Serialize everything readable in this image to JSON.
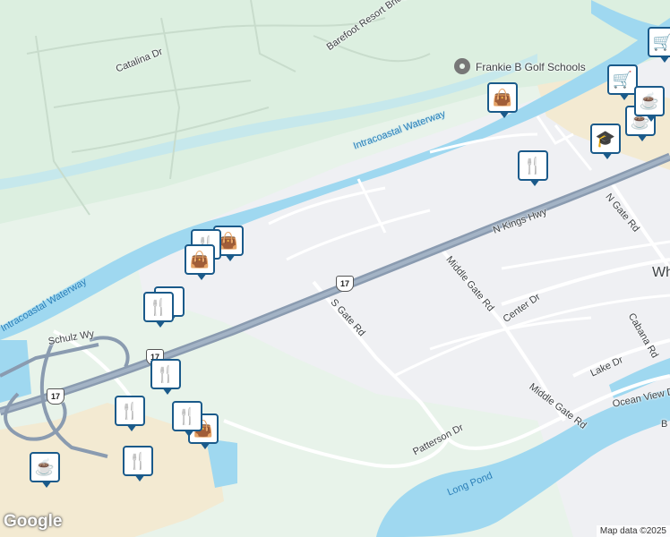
{
  "map": {
    "attribution": "Map data ©2025",
    "logo": "Google",
    "route_shield": "17",
    "colors": {
      "land": "#e8f3ea",
      "urban": "#eff0f3",
      "water": "#9fd8f0",
      "highway": "#8a9bb0",
      "sand": "#f3ead2",
      "pin_border": "#1a5a8a"
    }
  },
  "labels": {
    "catalina_dr": "Catalina Dr",
    "barefoot_bridge": "Barefoot Resort Bridge",
    "frankie_b": "Frankie B Golf Schools",
    "intracoastal_1": "Intracoastal Waterway",
    "intracoastal_2": "Intracoastal Waterway",
    "n_kings_hwy": "N Kings Hwy",
    "schulz_wy": "Schulz Wy",
    "s_gate_rd": "S Gate Rd",
    "middle_gate_rd_1": "Middle Gate Rd",
    "middle_gate_rd_2": "Middle Gate Rd",
    "center_dr": "Center Dr",
    "n_gate_rd": "N Gate Rd",
    "cabana_rd": "Cabana Rd",
    "lake_dr": "Lake Dr",
    "ocean_view_dr": "Ocean View Dr",
    "patterson_dr": "Patterson Dr",
    "long_pond": "Long Pond",
    "wh": "Wh",
    "b": "B"
  },
  "pois": [
    {
      "type": "shopping-bag-icon",
      "glyph": "👜"
    },
    {
      "type": "restaurant-icon",
      "glyph": "🍴"
    },
    {
      "type": "shopping-bag-icon",
      "glyph": "👜"
    },
    {
      "type": "restaurant-icon",
      "glyph": "🍴"
    },
    {
      "type": "restaurant-icon",
      "glyph": "🍴"
    },
    {
      "type": "restaurant-icon",
      "glyph": "🍴"
    },
    {
      "type": "restaurant-icon",
      "glyph": "🍴"
    },
    {
      "type": "shopping-bag-icon",
      "glyph": "👜"
    },
    {
      "type": "restaurant-icon",
      "glyph": "🍴"
    },
    {
      "type": "restaurant-icon",
      "glyph": "🍴"
    },
    {
      "type": "cafe-icon",
      "glyph": "☕"
    },
    {
      "type": "shopping-bag-icon",
      "glyph": "👜"
    },
    {
      "type": "restaurant-icon",
      "glyph": "🍴"
    },
    {
      "type": "school-icon",
      "glyph": "🎓"
    },
    {
      "type": "cafe-icon",
      "glyph": "☕"
    },
    {
      "type": "shopping-cart-icon",
      "glyph": "🛒"
    },
    {
      "type": "shopping-cart-icon",
      "glyph": "🛒"
    },
    {
      "type": "cafe-icon",
      "glyph": "☕"
    }
  ]
}
